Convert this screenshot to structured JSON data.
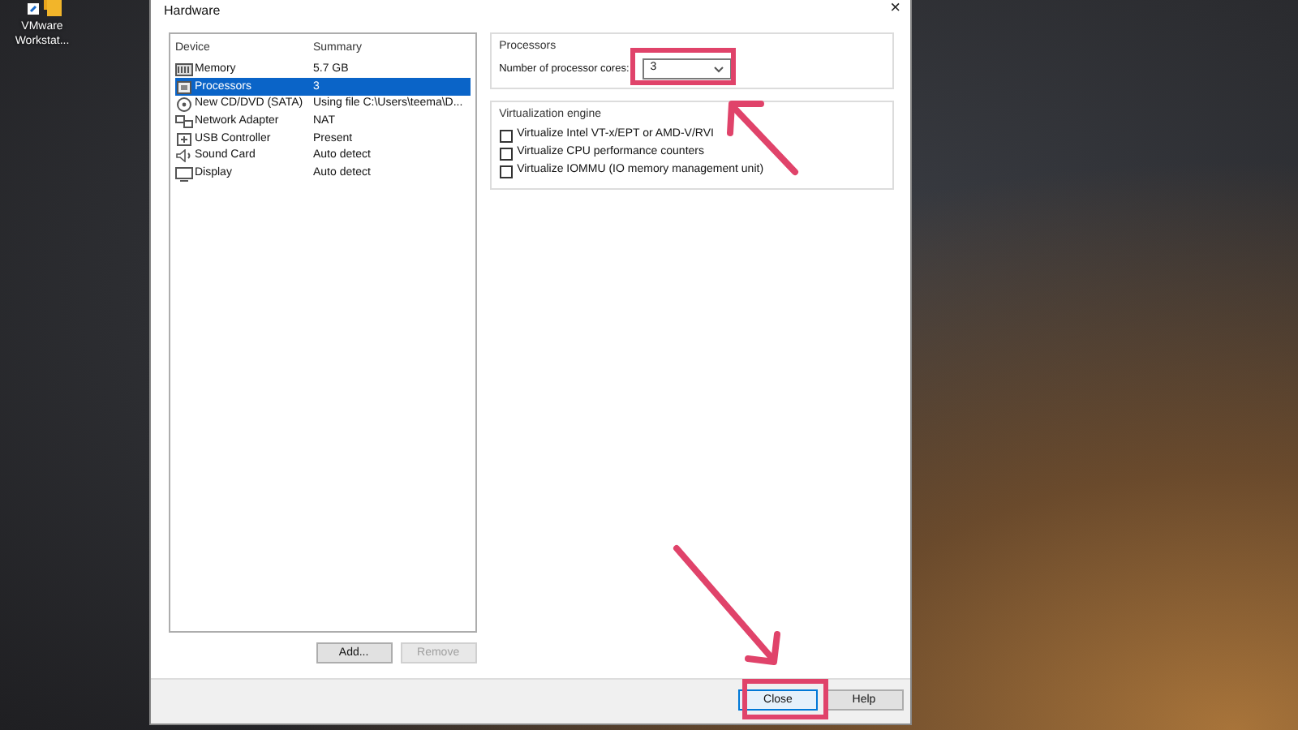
{
  "desktop_icons": [
    {
      "label": "VMware Workstat..."
    }
  ],
  "window": {
    "title": "Hardware",
    "close": "×"
  },
  "device_list": {
    "columns": [
      "Device",
      "Summary"
    ],
    "rows": [
      {
        "kind": "memory",
        "device": "Memory",
        "summary": "5.7 GB",
        "selected": false
      },
      {
        "kind": "processor",
        "device": "Processors",
        "summary": "3",
        "selected": true
      },
      {
        "kind": "disc",
        "device": "New CD/DVD (SATA)",
        "summary": "Using file C:\\Users\\teema\\D...",
        "selected": false
      },
      {
        "kind": "network",
        "device": "Network Adapter",
        "summary": "NAT",
        "selected": false
      },
      {
        "kind": "usb",
        "device": "USB Controller",
        "summary": "Present",
        "selected": false
      },
      {
        "kind": "sound",
        "device": "Sound Card",
        "summary": "Auto detect",
        "selected": false
      },
      {
        "kind": "display",
        "device": "Display",
        "summary": "Auto detect",
        "selected": false
      }
    ]
  },
  "list_buttons": [
    {
      "label": "Add...",
      "disabled": false
    },
    {
      "label": "Remove",
      "disabled": true
    }
  ],
  "processors": {
    "title": "Processors",
    "cores_label": "Number of processor cores:",
    "cores_value": "3"
  },
  "virtualization": {
    "title": "Virtualization engine",
    "options": [
      {
        "label": "Virtualize Intel VT-x/EPT or AMD-V/RVI",
        "checked": false
      },
      {
        "label": "Virtualize CPU performance counters",
        "checked": false
      },
      {
        "label": "Virtualize IOMMU (IO memory management unit)",
        "checked": false
      }
    ]
  },
  "footer_buttons": [
    {
      "label": "Close",
      "selected": true
    },
    {
      "label": "Help",
      "selected": false
    }
  ]
}
